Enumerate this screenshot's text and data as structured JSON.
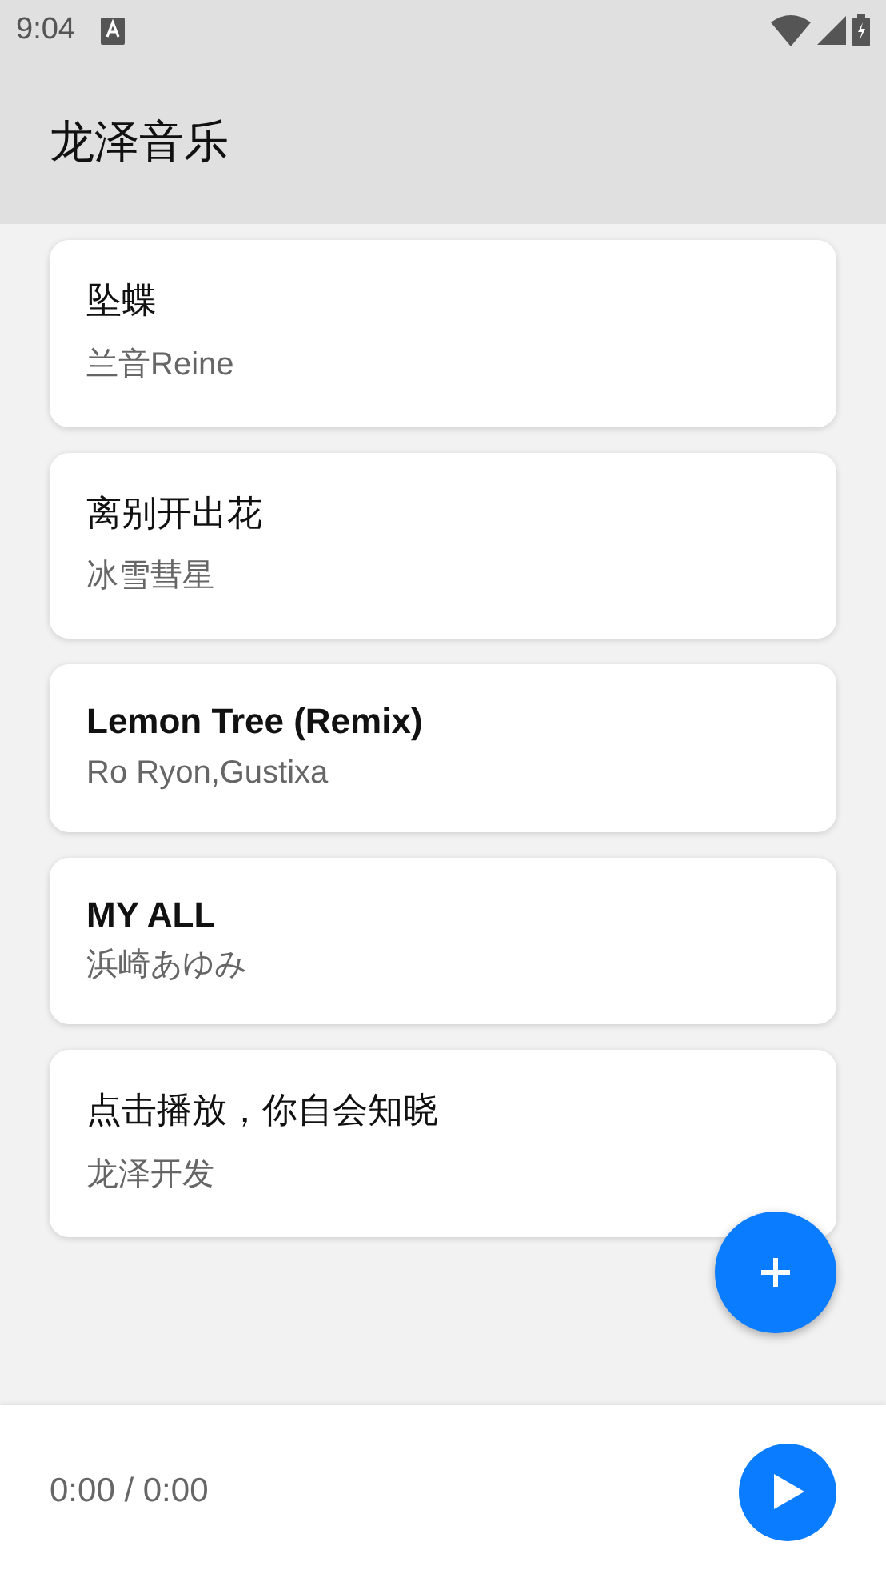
{
  "status_bar": {
    "time": "9:04"
  },
  "app_bar": {
    "title": "龙泽音乐"
  },
  "songs": [
    {
      "title": "坠蝶",
      "artist": "兰音Reine",
      "kind": "plain"
    },
    {
      "title": "离别开出花",
      "artist": "冰雪彗星",
      "kind": "plain"
    },
    {
      "title": "Lemon Tree (Remix)",
      "artist": "Ro Ryon,Gustixa",
      "kind": "bold"
    },
    {
      "title": "MY ALL",
      "artist": "浜崎あゆみ",
      "kind": "bold"
    },
    {
      "title": "点击播放，你自会知晓",
      "artist": "龙泽开发",
      "kind": "plain"
    }
  ],
  "player": {
    "time": "0:00 / 0:00"
  }
}
